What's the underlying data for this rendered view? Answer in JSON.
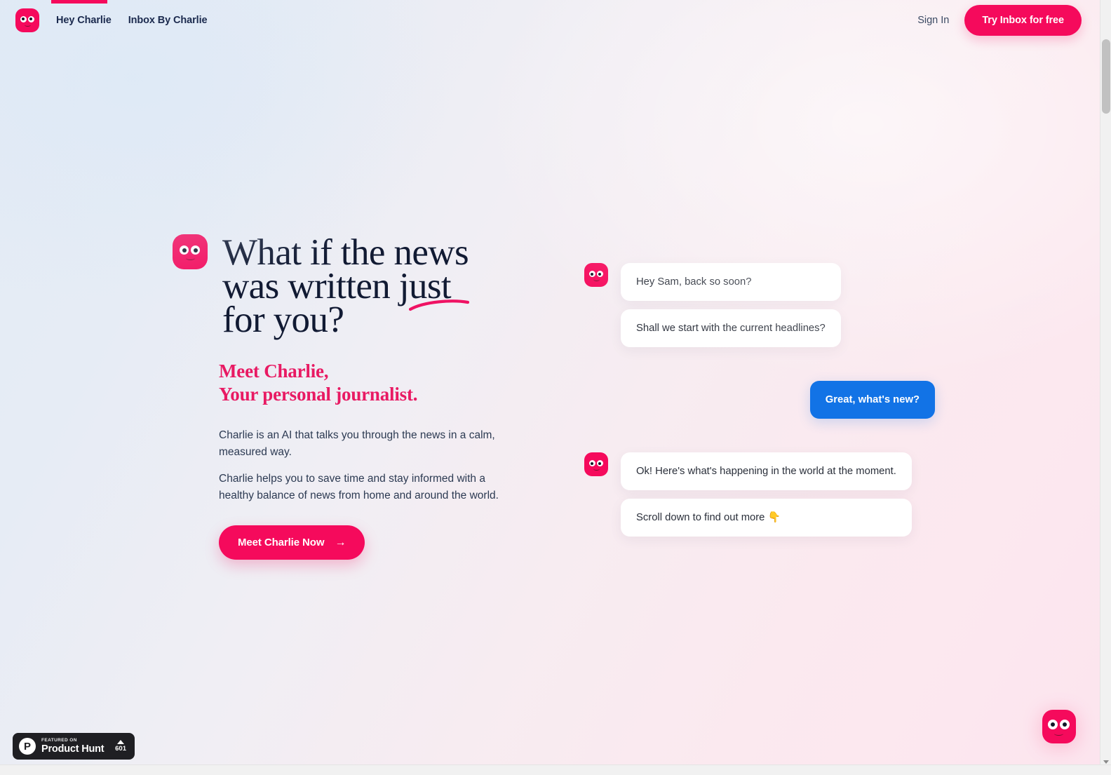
{
  "header": {
    "logo_icon": "charlie-face-icon",
    "nav": [
      {
        "label": "Hey Charlie",
        "active": true
      },
      {
        "label": "Inbox By Charlie",
        "active": false
      }
    ],
    "sign_in_label": "Sign In",
    "cta_label": "Try Inbox for free"
  },
  "hero": {
    "mark_icon": "charlie-face-icon",
    "headline_line1": "What if the news",
    "headline_line2": "was written just",
    "headline_line3": "for you?",
    "subhead_line1": "Meet Charlie,",
    "subhead_line2": "Your personal journalist.",
    "paragraph1": "Charlie is an AI that talks you through the news in a calm, measured way.",
    "paragraph2": "Charlie helps you to save time and stay informed with a healthy balance of news from home and around the world.",
    "button_label": "Meet Charlie Now",
    "button_arrow": "→"
  },
  "chat": {
    "avatar_icon": "charlie-face-icon",
    "group1": [
      "Hey Sam, back so soon?",
      "Shall we start with the current headlines?"
    ],
    "outgoing": "Great, what's new?",
    "group2": [
      "Ok! Here's what's happening in the world at the moment.",
      "Scroll down to find out more 👇"
    ]
  },
  "product_hunt": {
    "featured_label": "FEATURED ON",
    "name": "Product Hunt",
    "logo_letter": "P",
    "upvotes": "601"
  },
  "chat_widget": {
    "icon": "charlie-face-icon"
  },
  "colors": {
    "brand_pink": "#f50a5c",
    "subhead_pink": "#e81a63",
    "bubble_blue": "#1273e6",
    "navy_text": "#1b2a4e",
    "badge_dark": "#1f1f23"
  }
}
